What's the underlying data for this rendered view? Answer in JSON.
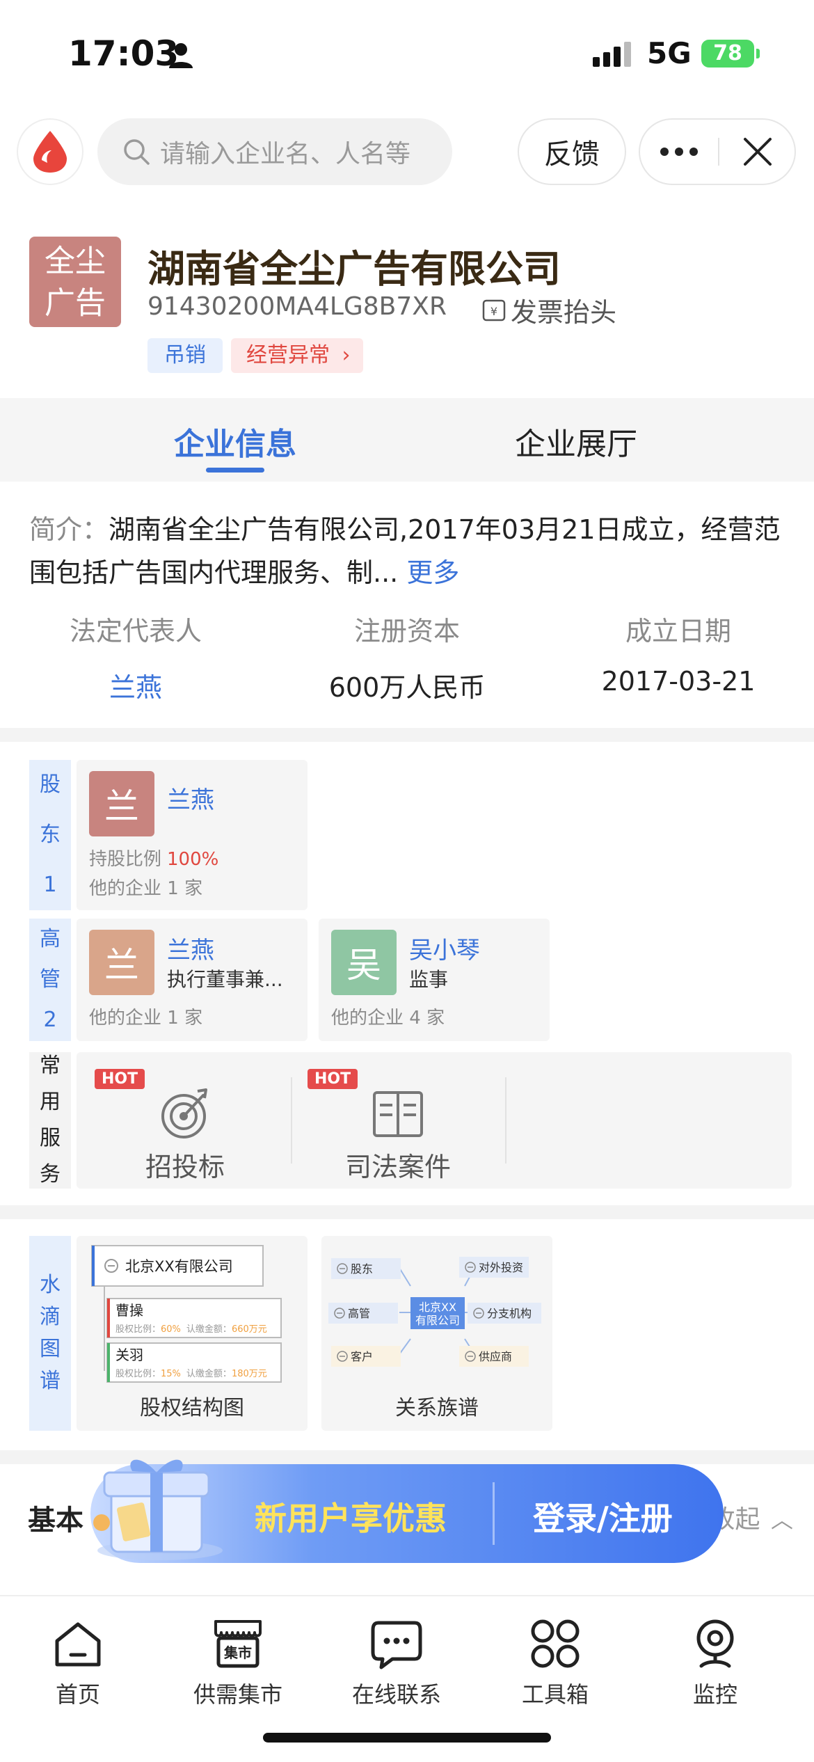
{
  "status": {
    "time": "17:03",
    "network": "5G",
    "battery": "78"
  },
  "search": {
    "placeholder": "请输入企业名、人名等"
  },
  "top_actions": {
    "feedback": "反馈"
  },
  "company": {
    "logo_text": "全尘广告",
    "logo_line1": "全尘",
    "logo_line2": "广告",
    "name": "湖南省全尘广告有限公司",
    "credit_code": "91430200MA4LG8B7XR",
    "invoice_label": "发票抬头",
    "tags": {
      "status": "吊销",
      "abnormal": "经营异常"
    }
  },
  "tabs": [
    {
      "label": "企业信息"
    },
    {
      "label": "企业展厅"
    }
  ],
  "intro": {
    "label": "简介：",
    "text": "湖南省全尘广告有限公司,2017年03月21日成立，经营范围包括广告国内代理服务、制...",
    "more": "更多"
  },
  "stats": [
    {
      "label": "法定代表人",
      "value": "兰燕"
    },
    {
      "label": "注册资本",
      "value": "600万人民币"
    },
    {
      "label": "成立日期",
      "value": "2017-03-21"
    }
  ],
  "shareholders": {
    "label": [
      "股",
      "东",
      "1"
    ],
    "items": [
      {
        "avatar": "兰",
        "name": "兰燕",
        "ratio_label": "持股比例",
        "ratio": "100%",
        "companies": "他的企业 1 家"
      }
    ]
  },
  "executives": {
    "label": [
      "高",
      "管",
      "2"
    ],
    "items": [
      {
        "avatar": "兰",
        "name": "兰燕",
        "role": "执行董事兼...",
        "companies": "他的企业 1 家"
      },
      {
        "avatar": "吴",
        "name": "吴小琴",
        "role": "监事",
        "companies": "他的企业 4 家"
      }
    ]
  },
  "services": {
    "label": [
      "常",
      "用",
      "服",
      "务"
    ],
    "items": [
      {
        "badge": "HOT",
        "label": "招投标",
        "icon": "target-icon"
      },
      {
        "badge": "HOT",
        "label": "司法案件",
        "icon": "book-icon"
      }
    ]
  },
  "graphs": {
    "label": [
      "水",
      "滴",
      "图",
      "谱"
    ],
    "equity": {
      "title": "股权结构图",
      "root": "北京XX有限公司",
      "holders": [
        {
          "name": "曹操",
          "ratio_label": "股权比例：",
          "ratio": "60%",
          "amount_label": "认缴金额：",
          "amount": "660万元"
        },
        {
          "name": "关羽",
          "ratio_label": "股权比例：",
          "ratio": "15%",
          "amount_label": "认缴金额：",
          "amount": "180万元"
        }
      ]
    },
    "relation": {
      "title": "关系族谱",
      "center": [
        "北京XX",
        "有限公司"
      ],
      "nodes": {
        "shareholder": "股东",
        "executive": "高管",
        "customer": "客户",
        "investment": "对外投资",
        "branch": "分支机构",
        "supplier": "供应商"
      }
    }
  },
  "basic": {
    "title": "基本",
    "collapse": "收起"
  },
  "promo": {
    "text": "新用户享优惠",
    "login": "登录/注册"
  },
  "nav": [
    {
      "label": "首页",
      "icon": "home-icon"
    },
    {
      "label": "供需集市",
      "icon": "market-icon",
      "icon_text": "集市"
    },
    {
      "label": "在线联系",
      "icon": "chat-icon"
    },
    {
      "label": "工具箱",
      "icon": "toolbox-icon"
    },
    {
      "label": "监控",
      "icon": "camera-icon"
    }
  ],
  "colors": {
    "accent": "#3b73d9",
    "danger": "#e0473f",
    "logo": "#c8847f",
    "exec2": "#8fc6a3"
  }
}
